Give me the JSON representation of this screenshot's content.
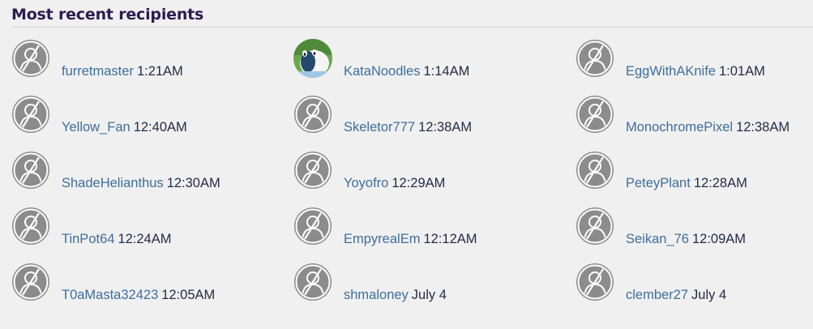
{
  "section": {
    "title": "Most recent recipients"
  },
  "colors": {
    "link": "#3e6f9c",
    "time": "#262b48",
    "title": "#2a1d4f",
    "avatar_gray": "#8c8c8c"
  },
  "recipients": [
    {
      "name": "furretmaster",
      "time": "1:21AM",
      "avatar": "default-avatar-icon"
    },
    {
      "name": "KataNoodles",
      "time": "1:14AM",
      "avatar": "custom-avatar-image"
    },
    {
      "name": "EggWithAKnife",
      "time": "1:01AM",
      "avatar": "default-avatar-icon"
    },
    {
      "name": "Yellow_Fan",
      "time": "12:40AM",
      "avatar": "default-avatar-icon"
    },
    {
      "name": "Skeletor777",
      "time": "12:38AM",
      "avatar": "default-avatar-icon"
    },
    {
      "name": "MonochromePixel",
      "time": "12:38AM",
      "avatar": "default-avatar-icon"
    },
    {
      "name": "ShadeHelianthus",
      "time": "12:30AM",
      "avatar": "default-avatar-icon"
    },
    {
      "name": "Yoyofro",
      "time": "12:29AM",
      "avatar": "default-avatar-icon"
    },
    {
      "name": "PeteyPlant",
      "time": "12:28AM",
      "avatar": "default-avatar-icon"
    },
    {
      "name": "TinPot64",
      "time": "12:24AM",
      "avatar": "default-avatar-icon"
    },
    {
      "name": "EmpyrealEm",
      "time": "12:12AM",
      "avatar": "default-avatar-icon"
    },
    {
      "name": "Seikan_76",
      "time": "12:09AM",
      "avatar": "default-avatar-icon"
    },
    {
      "name": "T0aMasta32423",
      "time": "12:05AM",
      "avatar": "default-avatar-icon"
    },
    {
      "name": "shmaloney",
      "time": "July 4",
      "avatar": "default-avatar-icon"
    },
    {
      "name": "clember27",
      "time": "July 4",
      "avatar": "default-avatar-icon"
    }
  ]
}
